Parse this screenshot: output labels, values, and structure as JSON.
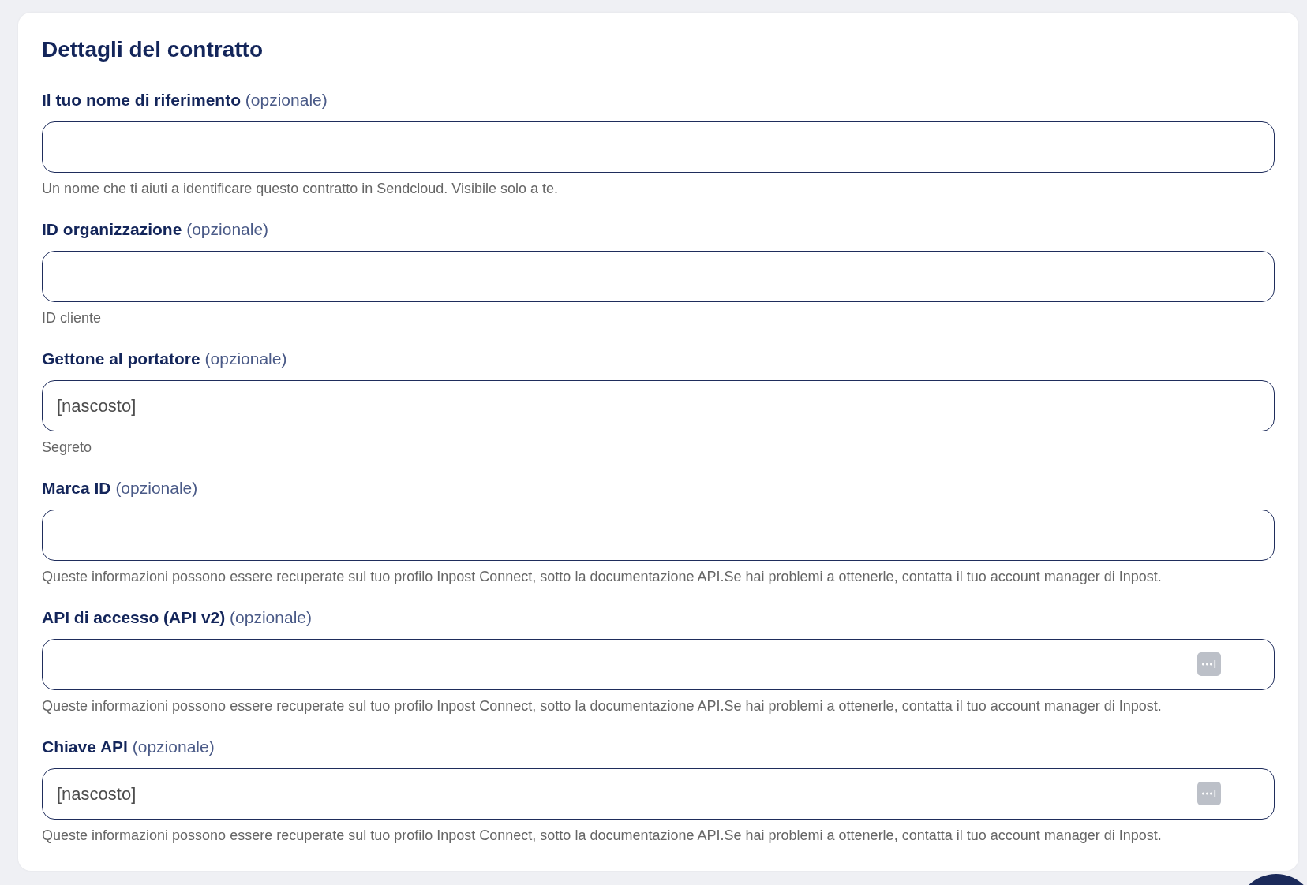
{
  "form": {
    "title": "Dettagli del contratto",
    "fields": [
      {
        "kind": "text",
        "label": "**Il tuo nome di riferimento** (opzionale)",
        "help": "Un nome che ti aiuti a identificare questo contratto in Sendcloud. Visibile solo a te."
      },
      {
        "kind": "text",
        "label": "**ID organizzazione** (opzionale)",
        "help": "ID cliente"
      },
      {
        "kind": "text",
        "label": "**Gettone al portatore** (opzionale)",
        "value": "[nascosto]",
        "help": "Segreto"
      },
      {
        "kind": "text",
        "label": "**Marca ID** (opzionale)",
        "help": "Queste informazioni possono essere recuperate sul tuo profilo Inpost Connect, sotto la documentazione API.Se hai problemi a ottenerle, contatta il tuo account manager di Inpost."
      },
      {
        "kind": "password",
        "label": "**API di accesso (API v2)** (opzionale)",
        "help": "Queste informazioni possono essere recuperate sul tuo profilo Inpost Connect, sotto la documentazione API.Se hai problemi a ottenerle, contatta il tuo account manager di Inpost."
      },
      {
        "kind": "password",
        "label": "**Chiave API** (opzionale)",
        "value": "[nascosto]",
        "help": "Queste informazioni possono essere recuperate sul tuo profilo Inpost Connect, sotto la documentazione API.Se hai problemi a ottenerle, contatta il tuo account manager di Inpost."
      }
    ]
  }
}
